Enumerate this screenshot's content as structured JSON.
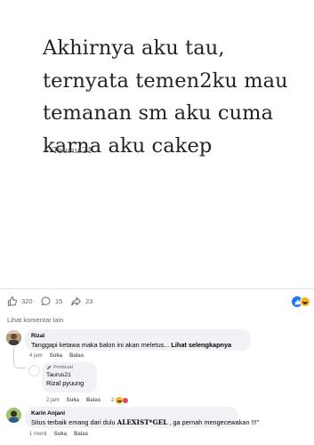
{
  "post": {
    "quote": "Akhirnya aku tau,\nternyata temen2ku mau\ntemanan sm aku cuma\nkarna aku cakep",
    "author": "~ Taurus21"
  },
  "reactions": {
    "likes": "320",
    "comments": "15",
    "shares": "23"
  },
  "more_comments_label": "Lihat komentar lain",
  "comments": [
    {
      "name": "Rizal",
      "text": "Tanggapi ketawa maka balon ini akan meletus...",
      "see_more": "Lihat selengkapnya",
      "time": "4 jam",
      "like": "Suka",
      "reply": "Balas"
    },
    {
      "badge": "Pembuat",
      "name": "Taurus21",
      "text": "Rizal pyuung",
      "time": "2 jam",
      "like": "Suka",
      "reply": "Balas",
      "reaction_count": "2"
    },
    {
      "name": "Karin Anjani",
      "text_before": "Situs terbaik emang dari dulu ",
      "text_highlight": "ALEXIST*GEL",
      "text_after": " , ga pernah mengecewakan !!!\"",
      "time": "1 menit",
      "like": "Suka",
      "reply": "Balas"
    }
  ],
  "colors": {
    "accent": "#1877f2",
    "bubble": "#f0f2f5",
    "muted": "#65676b"
  }
}
